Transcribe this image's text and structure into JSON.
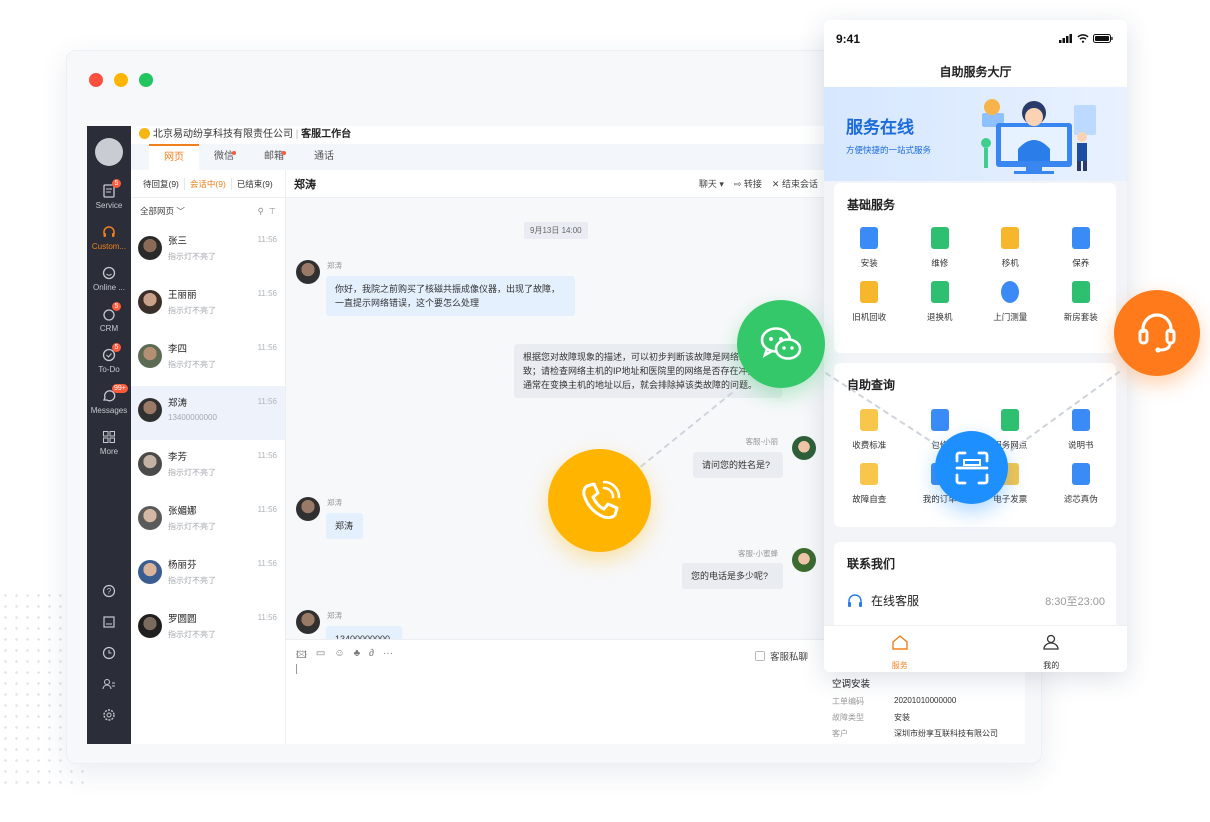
{
  "window": {
    "company": "北京易动纷享科技有限责任公司",
    "workspace": "客服工作台",
    "tabs": [
      "网页",
      "微信",
      "邮箱",
      "通话"
    ]
  },
  "nav": {
    "items": [
      {
        "label": "Service",
        "badge": "5"
      },
      {
        "label": "Custom...",
        "badge": ""
      },
      {
        "label": "Online ...",
        "badge": ""
      },
      {
        "label": "CRM",
        "badge": "5"
      },
      {
        "label": "To-Do",
        "badge": "5"
      },
      {
        "label": "Messages",
        "badge": "99+"
      },
      {
        "label": "More",
        "badge": ""
      }
    ]
  },
  "list": {
    "filters": [
      "待回复(9)",
      "会话中(9)",
      "已结束(9)"
    ],
    "all_pages": "全部网页",
    "items": [
      {
        "name": "张三",
        "sub": "指示灯不亮了",
        "time": "11:56"
      },
      {
        "name": "王丽丽",
        "sub": "指示灯不亮了",
        "time": "11:56"
      },
      {
        "name": "李四",
        "sub": "指示灯不亮了",
        "time": "11:56"
      },
      {
        "name": "郑涛",
        "sub": "13400000000",
        "time": "11:56"
      },
      {
        "name": "李芳",
        "sub": "指示灯不亮了",
        "time": "11:56"
      },
      {
        "name": "张媚娜",
        "sub": "指示灯不亮了",
        "time": "11:56"
      },
      {
        "name": "杨丽芬",
        "sub": "指示灯不亮了",
        "time": "11:56"
      },
      {
        "name": "罗圆圆",
        "sub": "指示灯不亮了",
        "time": "11:56"
      }
    ]
  },
  "chat": {
    "title": "郑涛",
    "actions": [
      "聊天 ▾",
      "转接",
      "结束会话"
    ],
    "date": "9月13日 14:00",
    "messages": [
      {
        "who": "郑涛",
        "text": "你好，我院之前购买了核磁共振成像仪器，出现了故障，一直提示网络错误，这个要怎么处理"
      },
      {
        "who": "",
        "text": "根据您对故障现象的描述，可以初步判断该故障是网络冲突导致；请检查网络主机的IP地址和医院里的网络是否存在冲突，通常在变换主机的地址以后，就会排除掉该类故障的问题。"
      },
      {
        "who": "客服-小丽",
        "text": "请问您的姓名是?"
      },
      {
        "who": "郑涛",
        "text": "郑涛"
      },
      {
        "who": "客服-小蜜蜂",
        "text": "您的电话是多少呢?"
      },
      {
        "who": "郑涛",
        "text": "13400000000"
      }
    ],
    "private_label": "客服私聊"
  },
  "workorder": {
    "title": "空调安装",
    "rows": [
      {
        "k": "工单编码",
        "v": "20201010000000"
      },
      {
        "k": "故障类型",
        "v": "安装"
      },
      {
        "k": "客户",
        "v": "深圳市纷享互联科技有限公司"
      }
    ]
  },
  "phone": {
    "time": "9:41",
    "title": "自助服务大厅",
    "banner_title": "服务在线",
    "banner_sub": "方便快捷的一站式服务",
    "basic_title": "基础服务",
    "basic": [
      "安装",
      "维修",
      "移机",
      "保养",
      "旧机回收",
      "退换机",
      "上门测量",
      "新房套装"
    ],
    "query_title": "自助查询",
    "query": [
      "收费标准",
      "包修",
      "服务网点",
      "说明书",
      "故障自查",
      "我的订单",
      "电子发票",
      "滤芯真伪"
    ],
    "contact_title": "联系我们",
    "contact_item": "在线客服",
    "contact_hours": "8:30至23:00",
    "tab_service": "服务",
    "tab_mine": "我的"
  },
  "colors": {
    "accent": "#F0801E",
    "wechat": "#35C86B",
    "phone_badge": "#FFB400",
    "scan_badge": "#1E8FFF",
    "headset_badge": "#FF7A1A"
  }
}
